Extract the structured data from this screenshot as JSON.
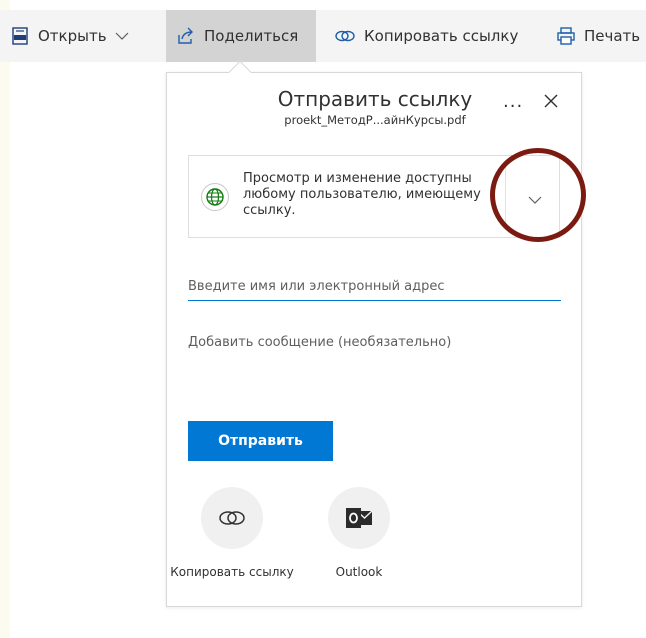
{
  "toolbar": {
    "open_label": "Открыть",
    "share_label": "Поделиться",
    "copy_link_label": "Копировать ссылку",
    "print_label": "Печать"
  },
  "dialog": {
    "title": "Отправить ссылку",
    "file_name": "proekt_МетодР...айнКурсы.pdf",
    "more_label": "...",
    "permission_text": "Просмотр и изменение доступны любому пользователю, имеющему ссылку.",
    "email_placeholder": "Введите имя или электронный адрес",
    "message_placeholder": "Добавить сообщение (необязательно)",
    "send_label": "Отправить",
    "copy_link_label": "Копировать ссылку",
    "outlook_label": "Outlook"
  },
  "icons": {
    "pdf": "pdf-file-icon",
    "share": "share-icon",
    "link": "link-icon",
    "print": "printer-icon",
    "globe": "globe-icon",
    "close": "close-icon",
    "chevron": "chevron-down-icon",
    "outlook": "outlook-icon"
  },
  "colors": {
    "accent": "#0078d4",
    "globe": "#107c10",
    "annotation": "#7a1a10",
    "outlook": "#2b2b2b"
  }
}
